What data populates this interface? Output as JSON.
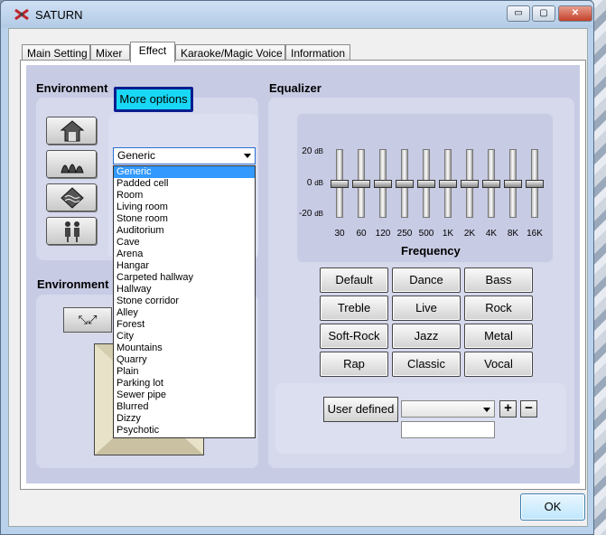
{
  "window": {
    "title": "SATURN",
    "min_glyph": "▭",
    "max_glyph": "▢",
    "close_glyph": "✕"
  },
  "tabs": [
    {
      "label": "Main Setting"
    },
    {
      "label": "Mixer"
    },
    {
      "label": "Effect"
    },
    {
      "label": "Karaoke/Magic Voice"
    },
    {
      "label": "Information"
    }
  ],
  "environment": {
    "title": "Environment",
    "title2": "Environment",
    "more_options_label": "More options",
    "selected": "Generic",
    "icons": [
      "house-icon",
      "opera-house-icon",
      "water-icon",
      "people-icon"
    ],
    "center_button_glyph": "⤡⤢",
    "options": [
      "Generic",
      "Padded cell",
      "Room",
      "Living room",
      "Stone room",
      "Auditorium",
      "Cave",
      "Arena",
      "Hangar",
      "Carpeted hallway",
      "Hallway",
      "Stone corridor",
      "Alley",
      "Forest",
      "City",
      "Mountains",
      "Quarry",
      "Plain",
      "Parking lot",
      "Sewer pipe",
      "Blurred",
      "Dizzy",
      "Psychotic"
    ]
  },
  "equalizer": {
    "title": "Equalizer",
    "db_top": "20",
    "db_mid": "0",
    "db_bottom": "-20",
    "db_unit": "dB",
    "frequency_title": "Frequency",
    "bands": [
      {
        "freq": "30",
        "gain": 0
      },
      {
        "freq": "60",
        "gain": 0
      },
      {
        "freq": "120",
        "gain": 0
      },
      {
        "freq": "250",
        "gain": 0
      },
      {
        "freq": "500",
        "gain": 0
      },
      {
        "freq": "1K",
        "gain": 0
      },
      {
        "freq": "2K",
        "gain": 0
      },
      {
        "freq": "4K",
        "gain": 0
      },
      {
        "freq": "8K",
        "gain": 0
      },
      {
        "freq": "16K",
        "gain": 0
      }
    ],
    "presets": [
      "Default",
      "Dance",
      "Bass",
      "Treble",
      "Live",
      "Rock",
      "Soft-Rock",
      "Jazz",
      "Metal",
      "Rap",
      "Classic",
      "Vocal"
    ],
    "user_defined_label": "User defined",
    "user_selected": "",
    "user_name_value": "",
    "plus_label": "+",
    "minus_label": "−"
  },
  "footer": {
    "ok_label": "OK"
  }
}
